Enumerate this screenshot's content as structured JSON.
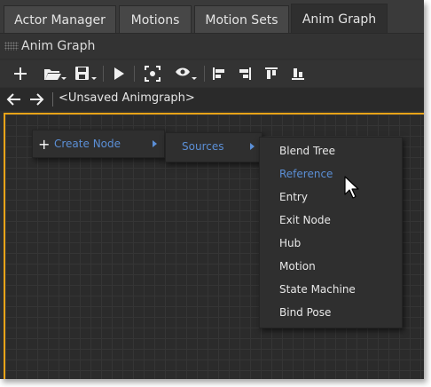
{
  "tabs": [
    {
      "label": "Actor Manager",
      "active": false
    },
    {
      "label": "Motions",
      "active": false
    },
    {
      "label": "Motion Sets",
      "active": false
    },
    {
      "label": "Anim Graph",
      "active": true
    }
  ],
  "panel": {
    "title": "Anim Graph"
  },
  "toolbar": {
    "icons": [
      "plus-icon",
      "folder-open-icon",
      "save-icon",
      "play-icon",
      "focus-icon",
      "visibility-icon",
      "align-left-icon",
      "align-right-icon",
      "align-top-icon",
      "align-bottom-icon"
    ]
  },
  "nav": {
    "breadcrumb": "<Unsaved Animgraph>"
  },
  "context_menu": {
    "create_node": "Create Node",
    "sources": "Sources",
    "items": [
      "Blend Tree",
      "Reference",
      "Entry",
      "Exit Node",
      "Hub",
      "Motion",
      "State Machine",
      "Bind Pose"
    ],
    "hover_index": 1
  },
  "colors": {
    "accent": "#e8a317",
    "highlight_text": "#5b8fd6",
    "panel_bg": "#2f2f2f",
    "canvas_bg": "#2b2b2b"
  }
}
